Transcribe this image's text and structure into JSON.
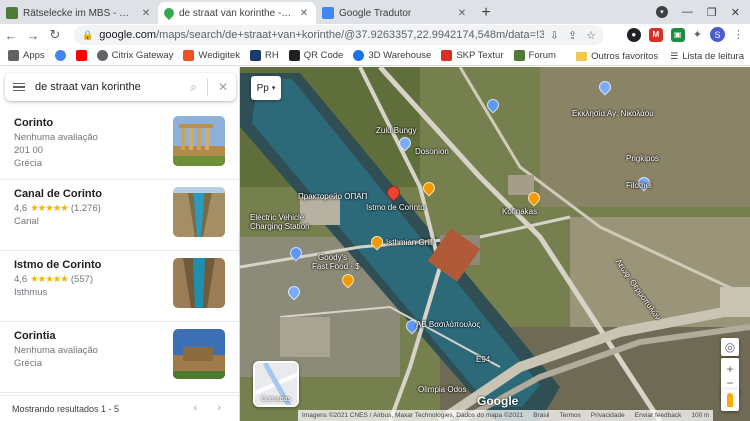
{
  "tabs": [
    {
      "title": "Rätselecke im MBS - Seite 27 - Al",
      "active": false,
      "favicon_color": "#4f7a3a"
    },
    {
      "title": "de straat van korinthe - Google M",
      "active": true,
      "favicon_color": "#34a853"
    },
    {
      "title": "Google Tradutor",
      "active": false,
      "favicon_color": "#4285f4"
    }
  ],
  "browser": {
    "url_host": "google.com",
    "url_rest": "/maps/search/de+straat+van+korinthe/@37.9263357,22.9942174,548m/data=!3m1!1e3",
    "avatar_letter": "S"
  },
  "bookmarks": [
    {
      "label": "Apps",
      "color": "#5f6368"
    },
    {
      "label": "",
      "color": "#4285f4"
    },
    {
      "label": "",
      "color": "#ff0000"
    },
    {
      "label": "Citrix Gateway",
      "color": "#5f6368"
    },
    {
      "label": "Wedigitek",
      "color": "#f25022"
    },
    {
      "label": "RH",
      "color": "#1a3a6b"
    },
    {
      "label": "QR Code",
      "color": "#202124"
    },
    {
      "label": "3D Warehouse",
      "color": "#1a73e8"
    },
    {
      "label": "SKP Textur",
      "color": "#d93025"
    },
    {
      "label": "Forum",
      "color": "#4f7a3a"
    }
  ],
  "bookmarks_right": {
    "other": "Outros favoritos",
    "reading": "Lista de leitura"
  },
  "search": {
    "value": "de straat van korinthe"
  },
  "results": [
    {
      "name": "Corinto",
      "line1": "Nenhuma avaliação",
      "line2": "201 00",
      "line3": "Grécia",
      "rating": "",
      "stars": "",
      "count": ""
    },
    {
      "name": "Canal de Corinto",
      "line1": "",
      "line2": "Canal",
      "line3": "",
      "rating": "4,6",
      "stars": "★★★★★",
      "count": "(1.276)"
    },
    {
      "name": "Istmo de Corinto",
      "line1": "",
      "line2": "Isthmus",
      "line3": "",
      "rating": "4,6",
      "stars": "★★★★★",
      "count": "(557)"
    },
    {
      "name": "Corintia",
      "line1": "Nenhuma avaliação",
      "line2": "Grécia",
      "line3": "",
      "rating": "",
      "stars": "",
      "count": ""
    }
  ],
  "footer": {
    "text": "Mostrando resultados 1 - 5"
  },
  "map": {
    "layer_chip": "Pр",
    "sat_caption": "Camadas",
    "labels": [
      {
        "text": "Zulu Bungy",
        "cls": "l1"
      },
      {
        "text": "Dosonion",
        "cls": "l2"
      },
      {
        "text": "Istmo de Corinto",
        "cls": "l3"
      },
      {
        "text": "Electric Vehicle",
        "cls": "l4"
      },
      {
        "text": "Charging Station",
        "cls": "l5"
      },
      {
        "text": "Isthmian Grill",
        "cls": "l6"
      },
      {
        "text": "Goody's",
        "cls": "l7"
      },
      {
        "text": "Fast Food · $",
        "cls": "l8"
      },
      {
        "text": "Kofinakas",
        "cls": "l9"
      },
      {
        "text": "ΑΒ Βασιλόπουλος",
        "cls": "l10"
      },
      {
        "text": "Εκκλησία Αγ. Νικολάου",
        "cls": "l11"
      },
      {
        "text": "Prigkipos",
        "cls": "l12"
      },
      {
        "text": "Filothei",
        "cls": "l13"
      },
      {
        "text": "Olimpia Odos",
        "cls": "l14"
      },
      {
        "text": "E94",
        "cls": "l15"
      },
      {
        "text": "Практорейо ОПАП",
        "cls": "l16"
      },
      {
        "text": "Λεωφ. Θερμοπυλών",
        "cls": "l17"
      }
    ],
    "attribution": [
      "Imagens ©2021 CNES / Airbus, Maxar Technologies, Dados do mapa ©2021",
      "Brasil",
      "Termos",
      "Privacidade",
      "Enviar feedback",
      "100 m"
    ],
    "brand": "Google"
  }
}
